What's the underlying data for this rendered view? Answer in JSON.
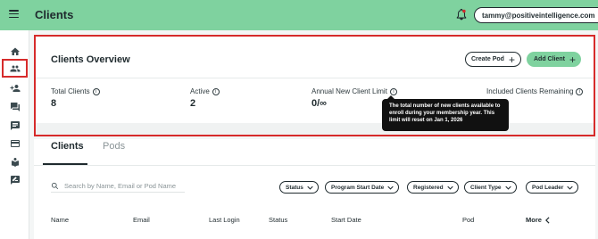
{
  "header": {
    "title": "Clients",
    "user_email": "tammy@positiveintelligence.com"
  },
  "sidebar": {
    "items": [
      {
        "name": "home",
        "icon": "home-icon"
      },
      {
        "name": "clients",
        "icon": "people-icon",
        "active": true
      },
      {
        "name": "add-person",
        "icon": "person-add-icon"
      },
      {
        "name": "messages",
        "icon": "forum-icon"
      },
      {
        "name": "chat",
        "icon": "chat-icon"
      },
      {
        "name": "billing",
        "icon": "credit-card-icon"
      },
      {
        "name": "learning",
        "icon": "reader-icon"
      },
      {
        "name": "feedback",
        "icon": "feedback-icon"
      }
    ]
  },
  "overview": {
    "title": "Clients Overview",
    "create_pod_label": "Create Pod",
    "add_client_label": "Add Client",
    "stats": [
      {
        "label": "Total Clients",
        "value": "8"
      },
      {
        "label": "Active",
        "value": "2"
      },
      {
        "label": "Annual New Client Limit",
        "value": "0/∞"
      },
      {
        "label": "Included Clients Remaining",
        "value": ""
      }
    ],
    "tooltip": "The total number of new clients available to enroll during your membership year. This limit will reset on Jan 1, 2026"
  },
  "clients": {
    "tabs": [
      "Clients",
      "Pods"
    ],
    "search_placeholder": "Search by Name, Email or Pod Name",
    "filters": [
      "Status",
      "Program Start Date",
      "Registered",
      "Client Type",
      "Pod Leader"
    ],
    "columns": [
      "Name",
      "Email",
      "Last Login",
      "Status",
      "Start Date",
      "Pod",
      "More"
    ]
  },
  "colors": {
    "brand_green": "#7fd29f",
    "highlight_red": "#d62b2b",
    "text_dark": "#1f2a2e"
  }
}
